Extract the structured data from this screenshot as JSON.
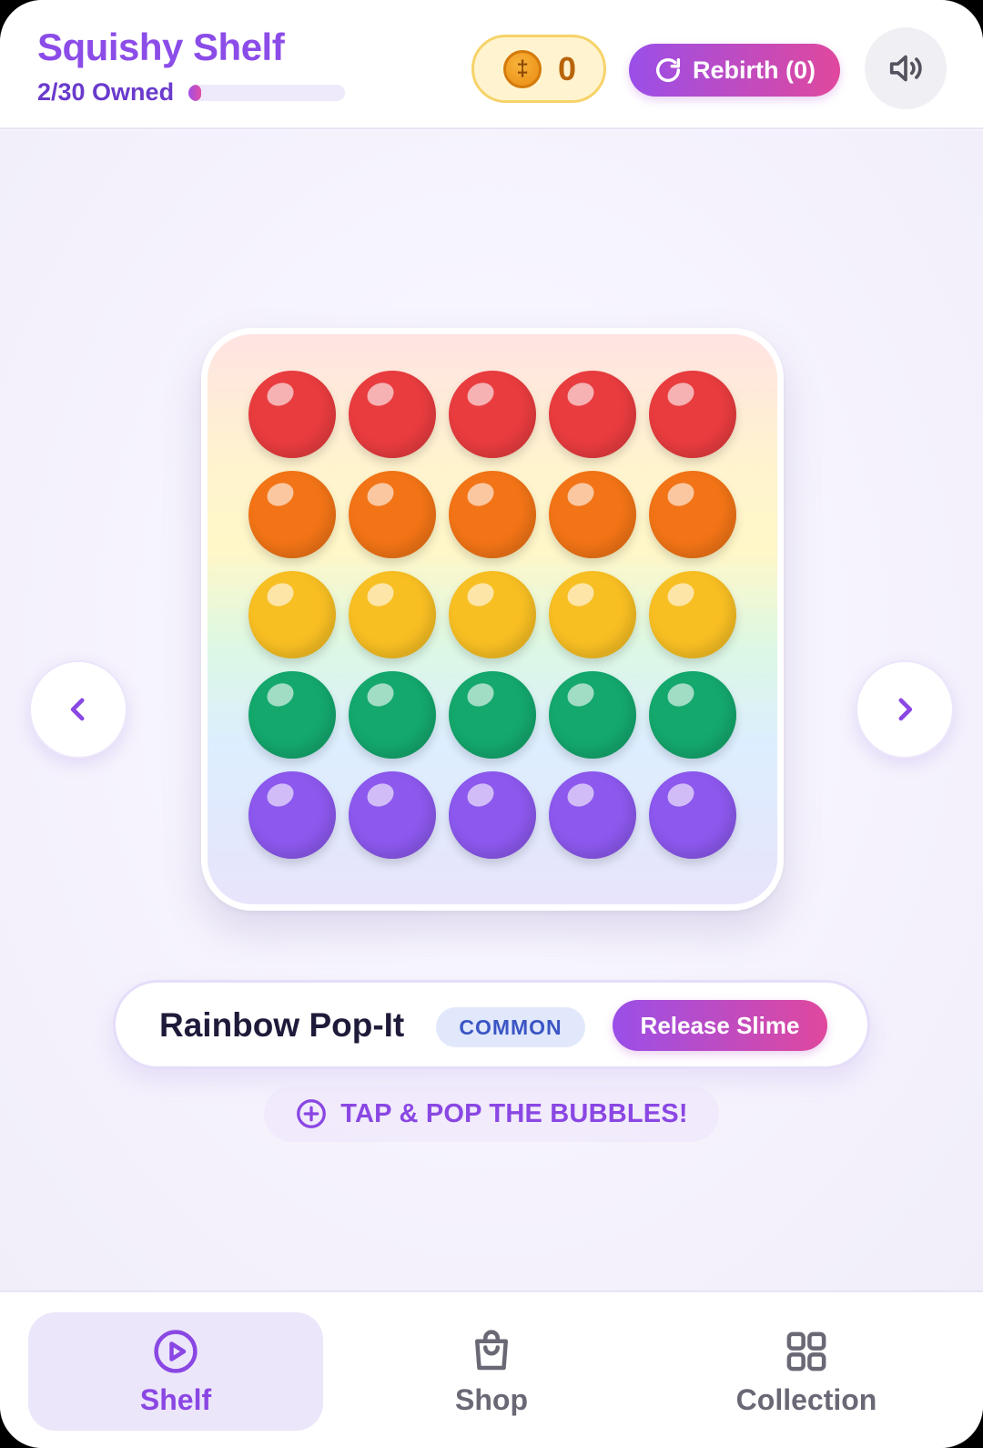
{
  "header": {
    "title": "Squishy Shelf",
    "owned_label": "2/30 Owned",
    "owned_progress": 0.067,
    "coins": "0",
    "coin_symbol": "‡",
    "rebirth_label": "Rebirth (0)"
  },
  "toy": {
    "name": "Rainbow Pop-It",
    "rarity": "COMMON",
    "release_label": "Release Slime",
    "hint": "TAP & POP THE BUBBLES!",
    "bubble_rows": [
      {
        "color": "#e93c3f"
      },
      {
        "color": "#f27416"
      },
      {
        "color": "#f8bf23"
      },
      {
        "color": "#14a86d"
      },
      {
        "color": "#8c58ee"
      }
    ],
    "bubbles_per_row": 5
  },
  "nav": {
    "tabs": [
      {
        "label": "Shelf",
        "icon": "play-circle-icon",
        "active": true
      },
      {
        "label": "Shop",
        "icon": "shopping-bag-icon",
        "active": false
      },
      {
        "label": "Collection",
        "icon": "grid-icon",
        "active": false
      }
    ]
  },
  "colors": {
    "accent": "#8b4ce8",
    "gradient_start": "#9a4fe8",
    "gradient_end": "#e0489d",
    "coin": "#e98b12"
  }
}
